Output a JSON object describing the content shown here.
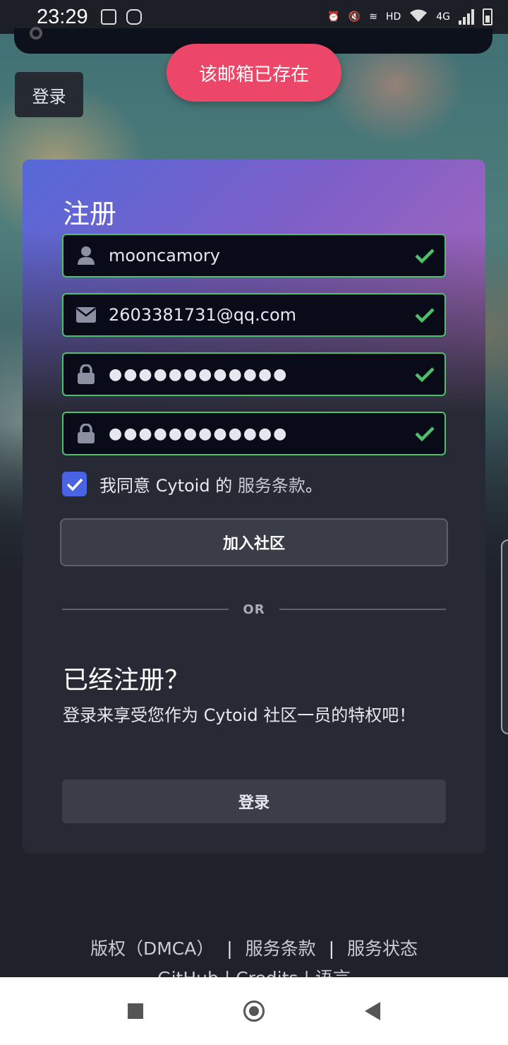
{
  "status_bar": {
    "time": "23:29",
    "network_label": "HD",
    "cell_label": "4G"
  },
  "toast": {
    "message": "该邮箱已存在"
  },
  "top_login_button": "登录",
  "register": {
    "title": "注册",
    "fields": [
      {
        "icon": "user-icon",
        "value": "mooncamory",
        "valid": true
      },
      {
        "icon": "envelope-icon",
        "value": "2603381731@qq.com",
        "valid": true
      },
      {
        "icon": "lock-icon",
        "value": "●●●●●●●●●●●●",
        "valid": true
      },
      {
        "icon": "lock-icon",
        "value": "●●●●●●●●●●●●",
        "valid": true
      }
    ],
    "agree_prefix": "我同意 Cytoid 的",
    "agree_link": "服务条款",
    "agree_suffix": "。",
    "agree_checked": true,
    "join_button": "加入社区",
    "or_text": "OR",
    "already_title": "已经注册？",
    "already_desc": "登录来享受您作为 Cytoid 社区一员的特权吧！",
    "login_button": "登录"
  },
  "footer": {
    "links": [
      "版权（DMCA）",
      "服务条款",
      "服务状态",
      "GitHub",
      "Credits",
      "语言"
    ],
    "separator": "|"
  },
  "colors": {
    "accent_blue": "#4a63e2",
    "valid_green": "#4cc06a",
    "toast_red": "#ec4768"
  }
}
